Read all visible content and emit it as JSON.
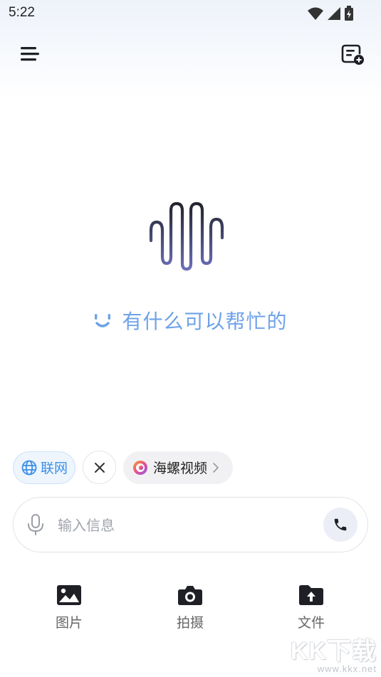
{
  "status_bar": {
    "time": "5:22",
    "icons": [
      "wifi-icon",
      "signal-icon",
      "battery-icon"
    ]
  },
  "header": {
    "menu_icon": "menu-icon",
    "new_chat_icon": "new-chat-icon"
  },
  "greeting": {
    "text": "有什么可以帮忙的"
  },
  "chips": {
    "web_label": "联网",
    "video_label": "海螺视频"
  },
  "input": {
    "placeholder": "输入信息",
    "value": ""
  },
  "tools": [
    {
      "label": "图片",
      "icon": "image-icon"
    },
    {
      "label": "拍摄",
      "icon": "camera-icon"
    },
    {
      "label": "文件",
      "icon": "file-upload-icon"
    }
  ],
  "watermark": {
    "brand": "KK下载",
    "url": "www.kkx.net"
  },
  "colors": {
    "accent_blue": "#3d8fe6",
    "greeting_blue": "#6ea2e8",
    "logo_dark": "#2b2d38",
    "logo_purple": "#6a6fb8"
  }
}
